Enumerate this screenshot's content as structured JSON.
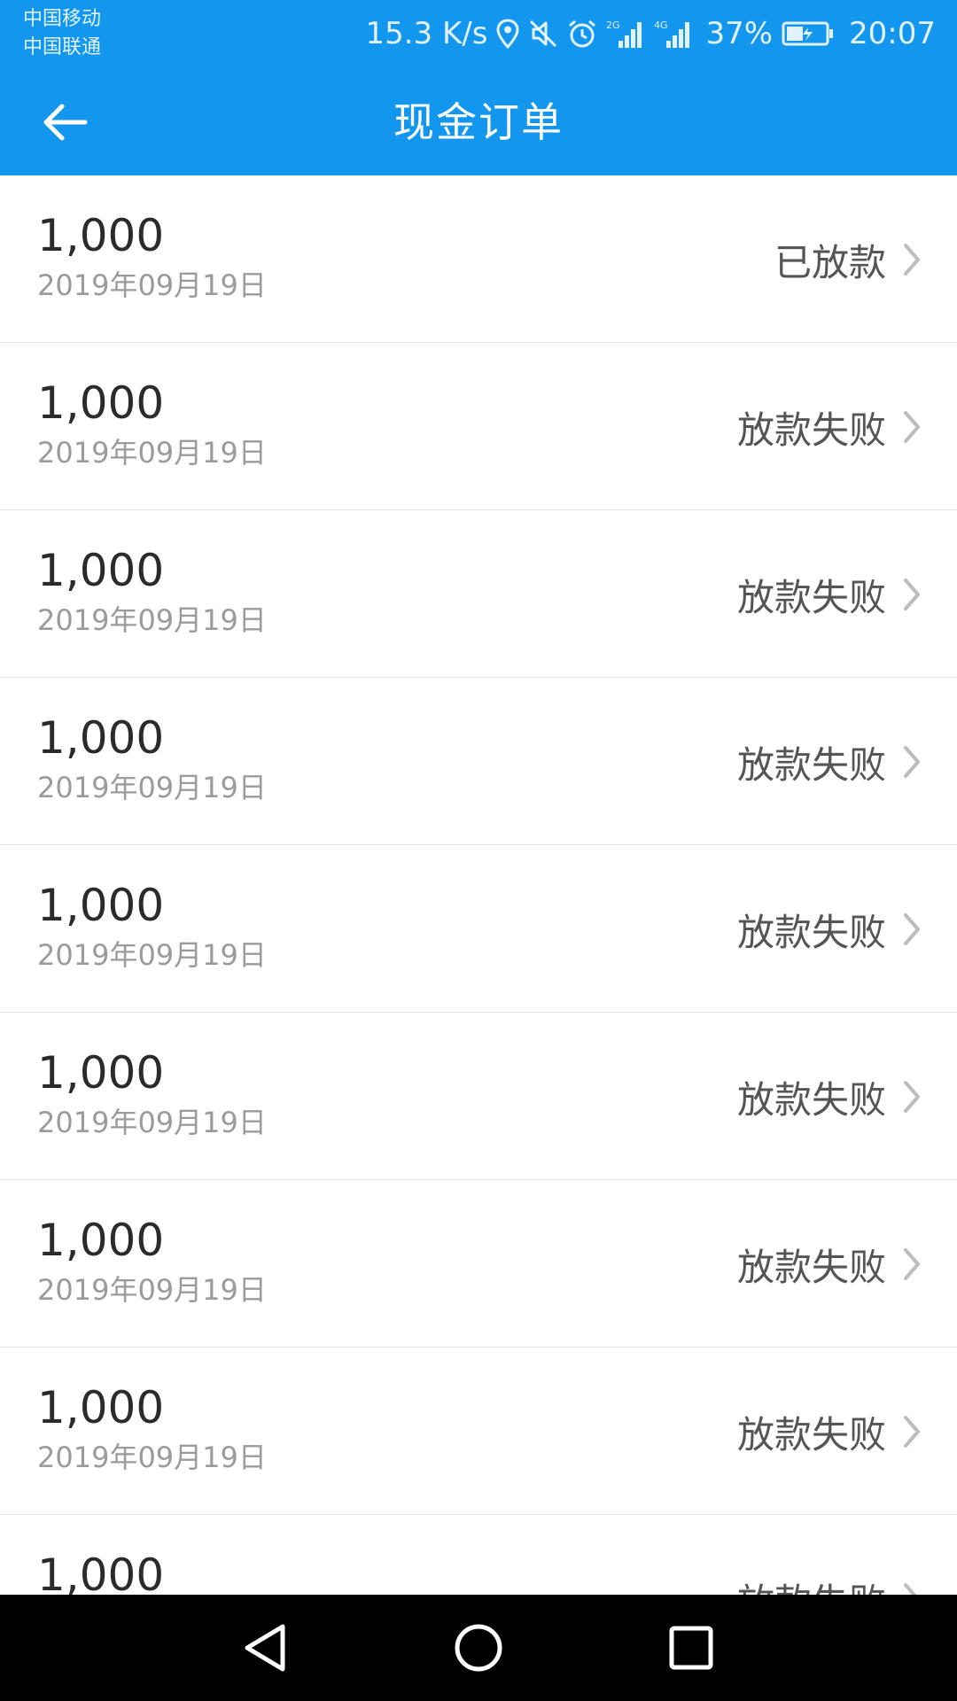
{
  "status_bar": {
    "carrier_1": "中国移动",
    "carrier_2": "中国联通",
    "net_speed": "15.3 K/s",
    "battery": "37%",
    "time": "20:07",
    "signal_1_label": "2G",
    "signal_2_label": "4G",
    "icons": [
      "location-icon",
      "mute-icon",
      "alarm-icon",
      "signal-icon",
      "battery-charging-icon"
    ]
  },
  "header": {
    "title": "现金订单"
  },
  "orders": [
    {
      "amount": "1,000",
      "date": "2019年09月19日",
      "status": "已放款"
    },
    {
      "amount": "1,000",
      "date": "2019年09月19日",
      "status": "放款失败"
    },
    {
      "amount": "1,000",
      "date": "2019年09月19日",
      "status": "放款失败"
    },
    {
      "amount": "1,000",
      "date": "2019年09月19日",
      "status": "放款失败"
    },
    {
      "amount": "1,000",
      "date": "2019年09月19日",
      "status": "放款失败"
    },
    {
      "amount": "1,000",
      "date": "2019年09月19日",
      "status": "放款失败"
    },
    {
      "amount": "1,000",
      "date": "2019年09月19日",
      "status": "放款失败"
    },
    {
      "amount": "1,000",
      "date": "2019年09月19日",
      "status": "放款失败"
    },
    {
      "amount": "1,000",
      "date": "",
      "status": "放款失败"
    }
  ],
  "colors": {
    "header_bg": "#1296ee",
    "amount_text": "#2b2b2b",
    "date_text": "#9b9b9b",
    "status_text": "#555555"
  }
}
